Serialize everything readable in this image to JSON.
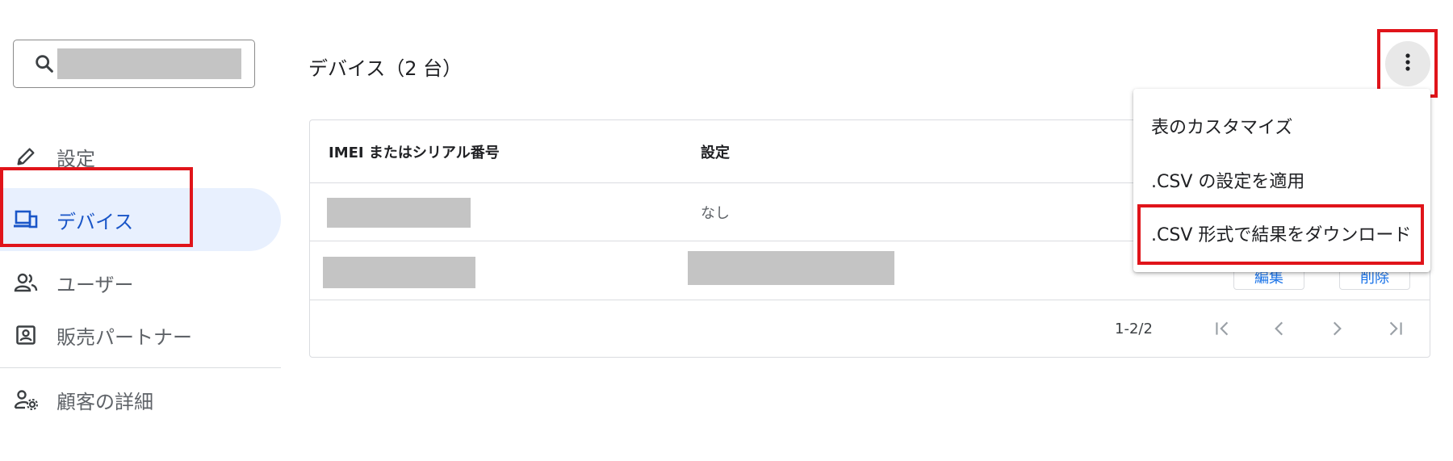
{
  "search": {
    "value": ""
  },
  "sidebar": {
    "items": [
      {
        "label": "設定",
        "icon": "pencil-icon"
      },
      {
        "label": "デバイス",
        "icon": "devices-icon",
        "active": true
      },
      {
        "label": "ユーザー",
        "icon": "users-icon"
      },
      {
        "label": "販売パートナー",
        "icon": "partner-badge-icon"
      },
      {
        "label": "顧客の詳細",
        "icon": "user-settings-icon"
      }
    ]
  },
  "header": {
    "title": "デバイス（2 台）"
  },
  "table": {
    "columns": [
      "IMEI またはシリアル番号",
      "設定"
    ],
    "rows": [
      {
        "serial": "",
        "setting": "なし"
      },
      {
        "serial": "",
        "setting": "",
        "actions": [
          "編集",
          "削除"
        ]
      }
    ],
    "pagination": {
      "range": "1-2/2"
    }
  },
  "menu": {
    "items": [
      "表のカスタマイズ",
      ".CSV の設定を適用",
      ".CSV 形式で結果をダウンロード"
    ]
  },
  "colors": {
    "accent": "#1a73e8",
    "highlight": "#e0141a",
    "active_bg": "#e8f0fe"
  }
}
